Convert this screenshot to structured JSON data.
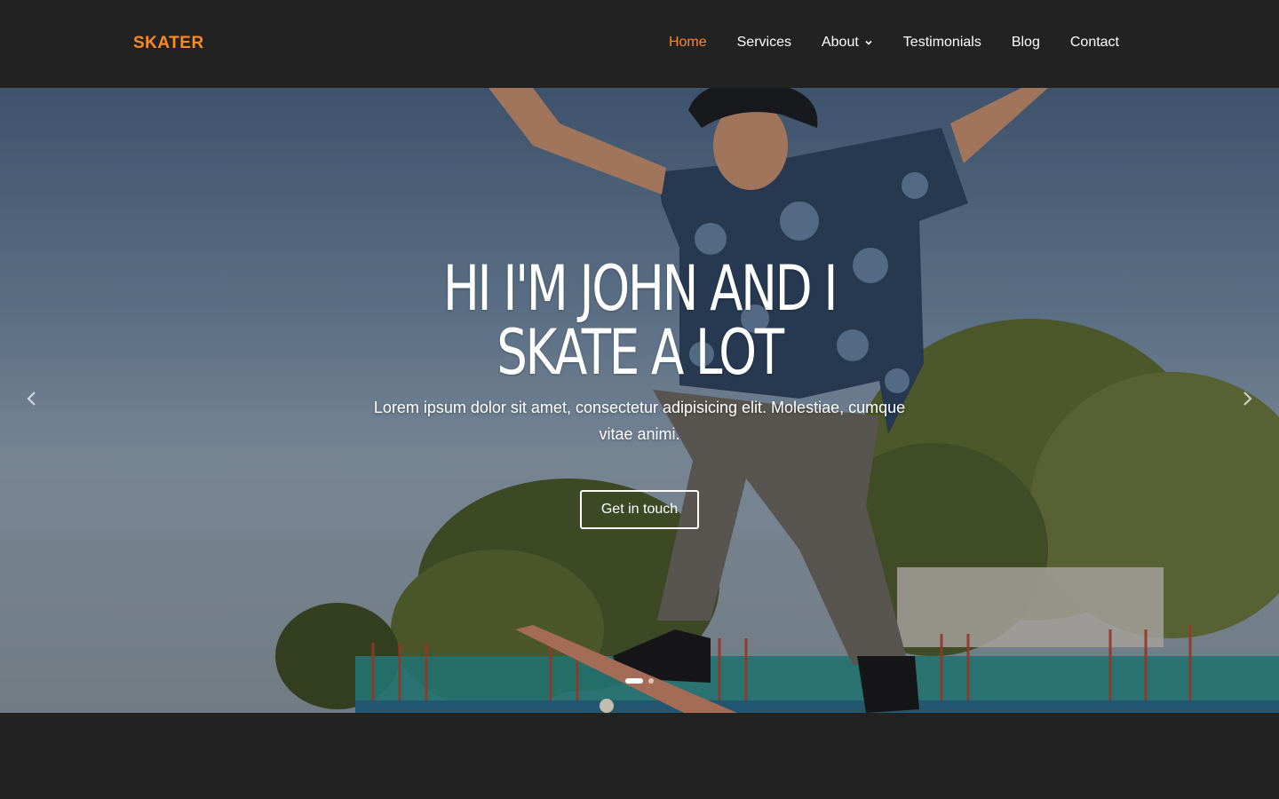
{
  "brand": {
    "name": "SKATER",
    "color": "#ff8a1f"
  },
  "nav": {
    "items": [
      {
        "label": "Home",
        "active": true
      },
      {
        "label": "Services",
        "active": false
      },
      {
        "label": "About",
        "active": false,
        "dropdown": true,
        "icon": "chevron-down-icon"
      },
      {
        "label": "Testimonials",
        "active": false
      },
      {
        "label": "Blog",
        "active": false
      },
      {
        "label": "Contact",
        "active": false
      }
    ]
  },
  "hero": {
    "title": "HI I'M JOHN AND I SKATE A LOT",
    "subtitle": "Lorem ipsum dolor sit amet, consectetur adipisicing elit. Molestiae, cumque vitae animi.",
    "cta_label": "Get in touch",
    "prev_icon": "chevron-left-icon",
    "next_icon": "chevron-right-icon",
    "slides_count": 2,
    "active_slide": 1
  },
  "colors": {
    "background": "#222222",
    "accent": "#ff8a1f",
    "text": "#ffffff"
  }
}
